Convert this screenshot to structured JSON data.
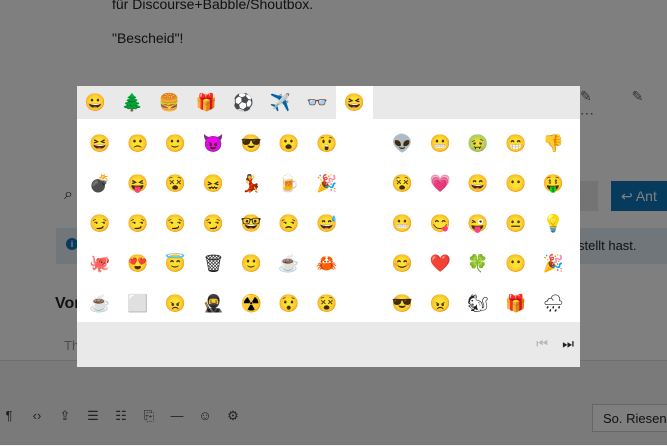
{
  "background": {
    "text_line1": "für Discourse+Babble/Shoutbox.",
    "text_line2": "\"Bescheid\"!",
    "right_icons": "✎ ✎ ⋯",
    "search_icon": "⌕",
    "answer_button": "↩ Ant",
    "info_icon": "i",
    "info_text": "stellt hast.",
    "heading": "Vor",
    "sub_text": "Th",
    "toolbar_icons": [
      "¶",
      "‹›",
      "⇪",
      "☰",
      "☷",
      "⎘",
      "—",
      "☺",
      "⚙"
    ],
    "select_value": "So. Riesen"
  },
  "emoji_picker": {
    "tabs": [
      {
        "name": "tab-smileys",
        "glyph": "😀"
      },
      {
        "name": "tab-nature",
        "glyph": "🌲"
      },
      {
        "name": "tab-food",
        "glyph": "🍔"
      },
      {
        "name": "tab-celebration",
        "glyph": "🎁"
      },
      {
        "name": "tab-activity",
        "glyph": "⚽"
      },
      {
        "name": "tab-travel",
        "glyph": "✈️"
      },
      {
        "name": "tab-objects",
        "glyph": "👓"
      },
      {
        "name": "tab-custom",
        "glyph": "😆"
      }
    ],
    "active_tab": 7,
    "emojis": [
      "😆",
      "🙁",
      "🙂",
      "😈",
      "😎",
      "😮",
      "😲",
      "",
      "👽",
      "😬",
      "🤢",
      "😁",
      "👎",
      "💣",
      "😝",
      "😵",
      "😖",
      "💃",
      "🍺",
      "🎉",
      "",
      "😵",
      "💗",
      "😄",
      "😶",
      "🤑",
      "😏",
      "😏",
      "😏",
      "😏",
      "🤓",
      "😒",
      "😅",
      "",
      "😬",
      "😋",
      "😜",
      "😐",
      "💡",
      "🐙",
      "😍",
      "😇",
      "🗑",
      "🙂",
      "☕",
      "🦀",
      "",
      "😊",
      "❤️",
      "🍀",
      "😶",
      "🎉",
      "☕",
      "⬜",
      "😠",
      "🥷",
      "☢️",
      "😯",
      "😵",
      "",
      "😎",
      "😠",
      "🐿",
      "🎁",
      "🌧"
    ]
  },
  "pagination": {
    "first_label": "⏮",
    "last_label": "⏭"
  }
}
